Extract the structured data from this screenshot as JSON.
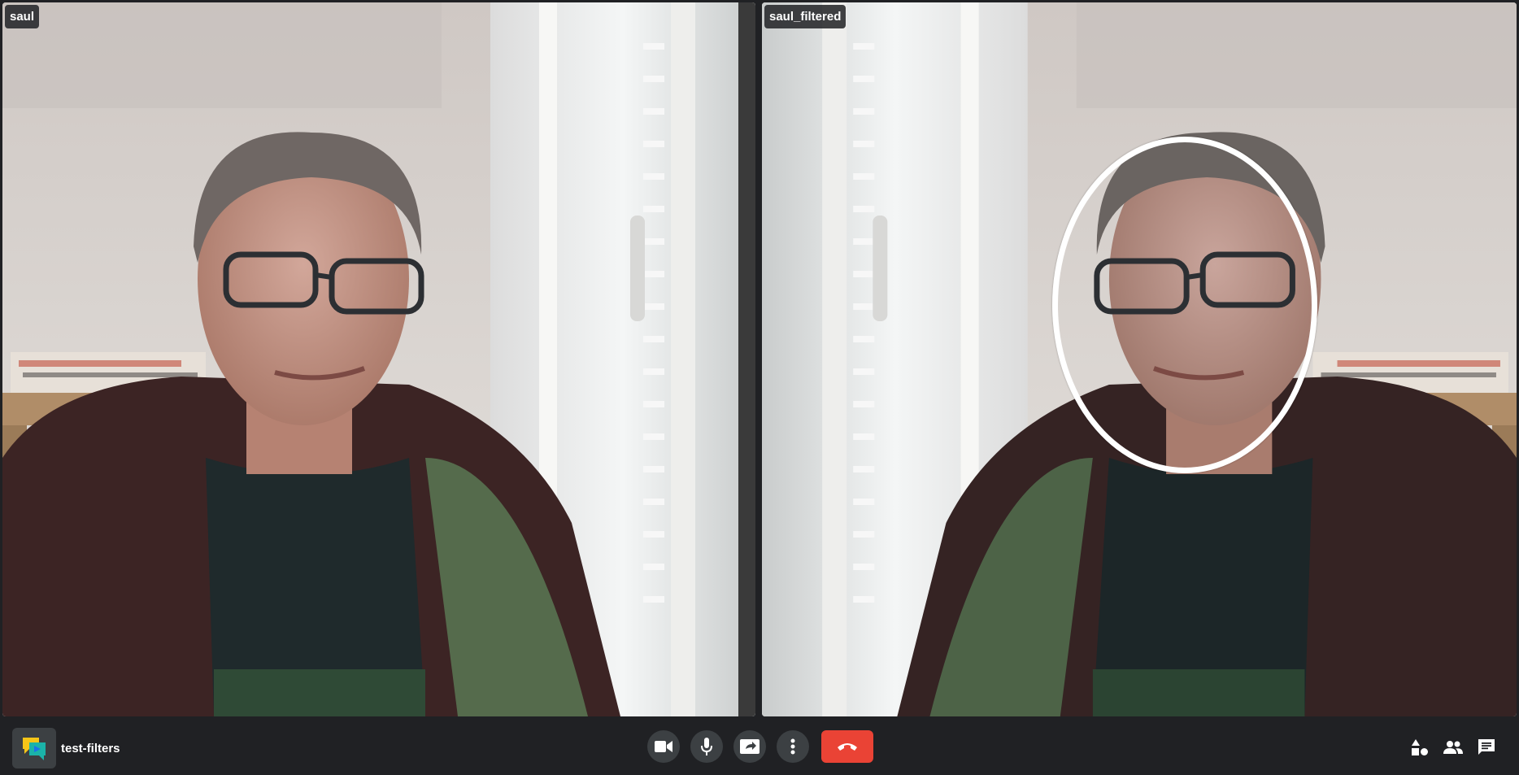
{
  "tiles": [
    {
      "participant_name": "saul"
    },
    {
      "participant_name": "saul_filtered"
    }
  ],
  "meeting": {
    "name": "test-filters",
    "logo_icon": "video-chat-logo-icon"
  },
  "controls": {
    "center": [
      "videocam-icon",
      "mic-icon",
      "present-screen-icon",
      "more-vert-icon",
      "call-end-icon"
    ],
    "right": [
      "activities-icon",
      "people-icon",
      "chat-icon"
    ],
    "hangup_color": "#ea4335"
  },
  "colors": {
    "bar_background": "#202124",
    "button_background": "#3c4043"
  }
}
